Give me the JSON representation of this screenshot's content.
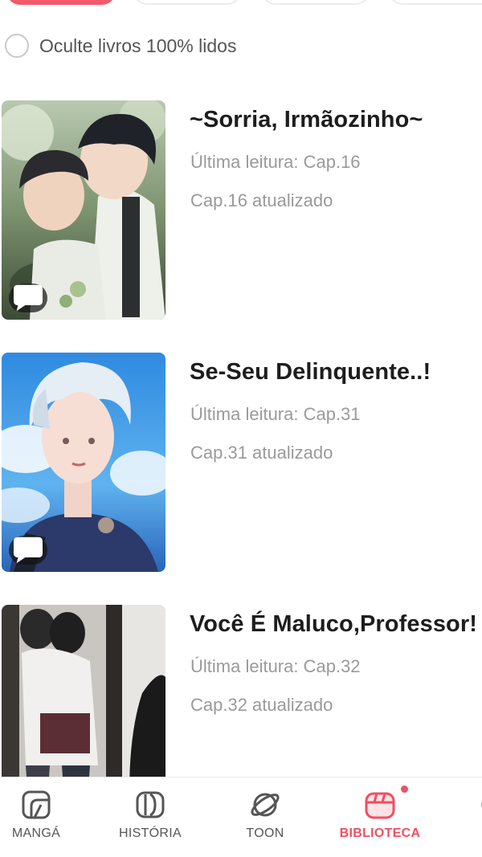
{
  "filter_bar": {
    "chips": [
      "",
      "",
      "",
      ""
    ]
  },
  "hide_read": {
    "label": "Oculte livros 100% lidos",
    "checked": false
  },
  "books": [
    {
      "title": "~Sorria, Irmãozinho~",
      "last_read": "Última leitura: Cap.16",
      "updated": "Cap.16 atualizado",
      "has_comment_badge": true
    },
    {
      "title": "Se-Seu Delinquente..!",
      "last_read": "Última leitura: Cap.31",
      "updated": "Cap.31 atualizado",
      "has_comment_badge": true
    },
    {
      "title": "Você É Maluco,Professor!",
      "last_read": "Última leitura: Cap.32",
      "updated": "Cap.32 atualizado",
      "has_comment_badge": false
    }
  ],
  "bottom_nav": {
    "items": [
      {
        "label": "MANGÁ",
        "icon": "manga-icon",
        "active": false
      },
      {
        "label": "HISTÓRIA",
        "icon": "book-icon",
        "active": false
      },
      {
        "label": "TOON",
        "icon": "planet-icon",
        "active": false
      },
      {
        "label": "BIBLIOTECA",
        "icon": "library-icon",
        "active": true,
        "has_notification_dot": true
      },
      {
        "label": "",
        "icon": "profile-icon",
        "active": false
      }
    ]
  },
  "colors": {
    "accent": "#ef4f62",
    "text_primary": "#1d1d1d",
    "text_secondary": "#9a9a9a",
    "nav_inactive": "#555555"
  }
}
